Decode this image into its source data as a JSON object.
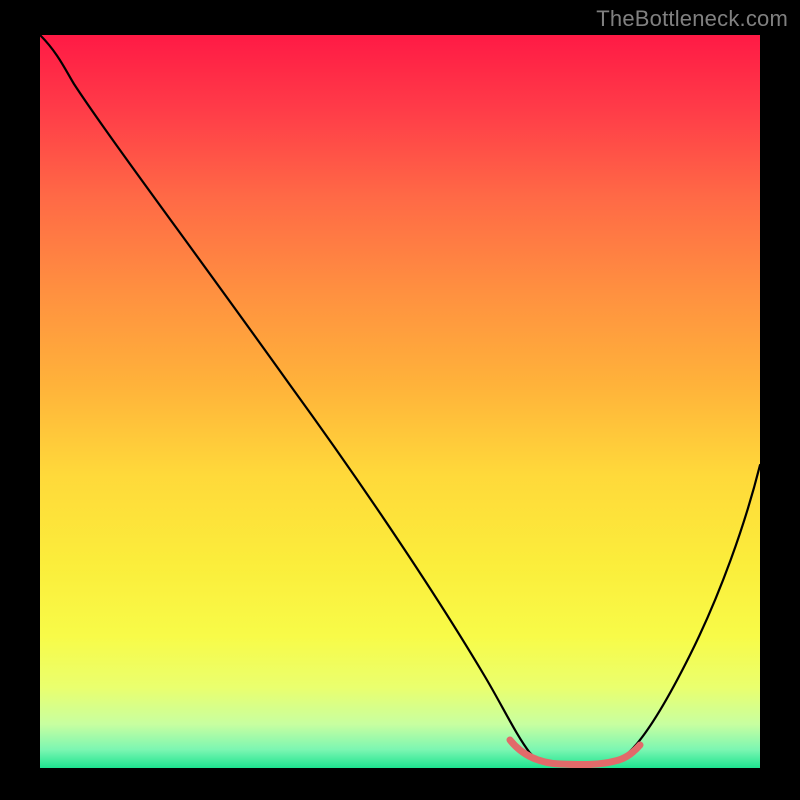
{
  "watermark": "TheBottleneck.com",
  "chart_data": {
    "type": "line",
    "title": "",
    "xlabel": "",
    "ylabel": "",
    "xlim": [
      0,
      100
    ],
    "ylim": [
      0,
      100
    ],
    "x": [
      0,
      4,
      10,
      20,
      30,
      40,
      50,
      60,
      63,
      67,
      72,
      77,
      80,
      85,
      90,
      95,
      100
    ],
    "values": [
      100,
      97,
      93.5,
      80,
      66,
      52,
      38,
      22,
      14,
      6,
      1.7,
      1.4,
      1.6,
      6,
      16,
      30,
      46
    ],
    "highlight_range_x": [
      63,
      80
    ],
    "gradient_stops": [
      {
        "pos": 0.0,
        "color": "#ff1a45"
      },
      {
        "pos": 0.5,
        "color": "#ffc838"
      },
      {
        "pos": 0.82,
        "color": "#f8fb48"
      },
      {
        "pos": 1.0,
        "color": "#1ee38f"
      }
    ]
  }
}
